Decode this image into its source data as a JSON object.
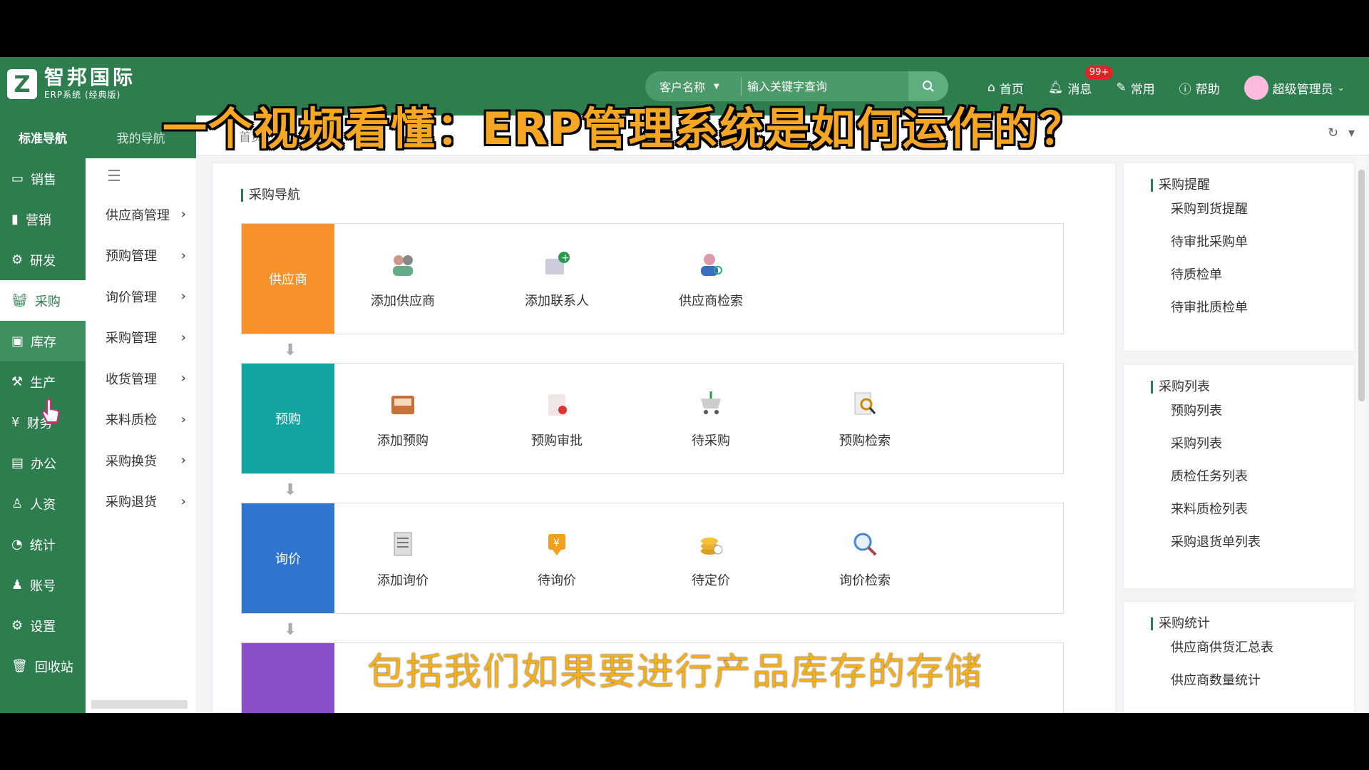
{
  "header": {
    "logo_name": "智邦国际",
    "logo_sub": "ERP系统 (经典版)",
    "search_type": "客户名称",
    "search_placeholder": "输入关键字查询",
    "nav": [
      {
        "label": "首页",
        "icon": "home-icon"
      },
      {
        "label": "消息",
        "icon": "bell-icon",
        "badge": "99+"
      },
      {
        "label": "常用",
        "icon": "tool-icon"
      },
      {
        "label": "帮助",
        "icon": "help-icon"
      },
      {
        "label": "超级管理员",
        "icon": "avatar"
      }
    ]
  },
  "sidebar": {
    "tab_standard": "标准导航",
    "tab_mine": "我的导航",
    "items": [
      {
        "label": "销售",
        "icon": "chat-icon"
      },
      {
        "label": "营销",
        "icon": "chart-icon"
      },
      {
        "label": "研发",
        "icon": "rnd-icon"
      },
      {
        "label": "采购",
        "icon": "basket-icon"
      },
      {
        "label": "库存",
        "icon": "warehouse-icon"
      },
      {
        "label": "生产",
        "icon": "factory-icon"
      },
      {
        "label": "财务",
        "icon": "yen-icon"
      },
      {
        "label": "办公",
        "icon": "briefcase-icon"
      },
      {
        "label": "人资",
        "icon": "person-icon"
      },
      {
        "label": "统计",
        "icon": "pie-icon"
      },
      {
        "label": "账号",
        "icon": "user-icon"
      },
      {
        "label": "设置",
        "icon": "settings-icon"
      },
      {
        "label": "回收站",
        "icon": "trash-icon"
      }
    ]
  },
  "subnav": {
    "items": [
      "供应商管理",
      "预购管理",
      "询价管理",
      "采购管理",
      "收货管理",
      "来料质检",
      "采购换货",
      "采购退货"
    ]
  },
  "tabs": {
    "home": "首页"
  },
  "main": {
    "section_title": "采购导航",
    "rows": [
      {
        "head": "供应商",
        "color": "#f7922b",
        "cells": [
          "添加供应商",
          "添加联系人",
          "供应商检索"
        ]
      },
      {
        "head": "预购",
        "color": "#12a3a3",
        "cells": [
          "添加预购",
          "预购审批",
          "待采购",
          "预购检索"
        ]
      },
      {
        "head": "询价",
        "color": "#2f75cf",
        "cells": [
          "添加询价",
          "待询价",
          "待定价",
          "询价检索"
        ]
      },
      {
        "head": "",
        "color": "#8a4fc9",
        "cells": []
      }
    ]
  },
  "right": {
    "panels": [
      {
        "title": "采购提醒",
        "links": [
          "采购到货提醒",
          "待审批采购单",
          "待质检单",
          "待审批质检单"
        ]
      },
      {
        "title": "采购列表",
        "links": [
          "预购列表",
          "采购列表",
          "质检任务列表",
          "来料质检列表",
          "采购退货单列表"
        ]
      },
      {
        "title": "采购统计",
        "links": [
          "供应商供货汇总表",
          "供应商数量统计"
        ]
      }
    ]
  },
  "overlay": {
    "title": "一个视频看懂：ERP管理系统是如何运作的？",
    "subtitle": "包括我们如果要进行产品库存的存储"
  },
  "colors": {
    "brand": "#2e7d4f",
    "overlay_text": "#f5a623"
  }
}
